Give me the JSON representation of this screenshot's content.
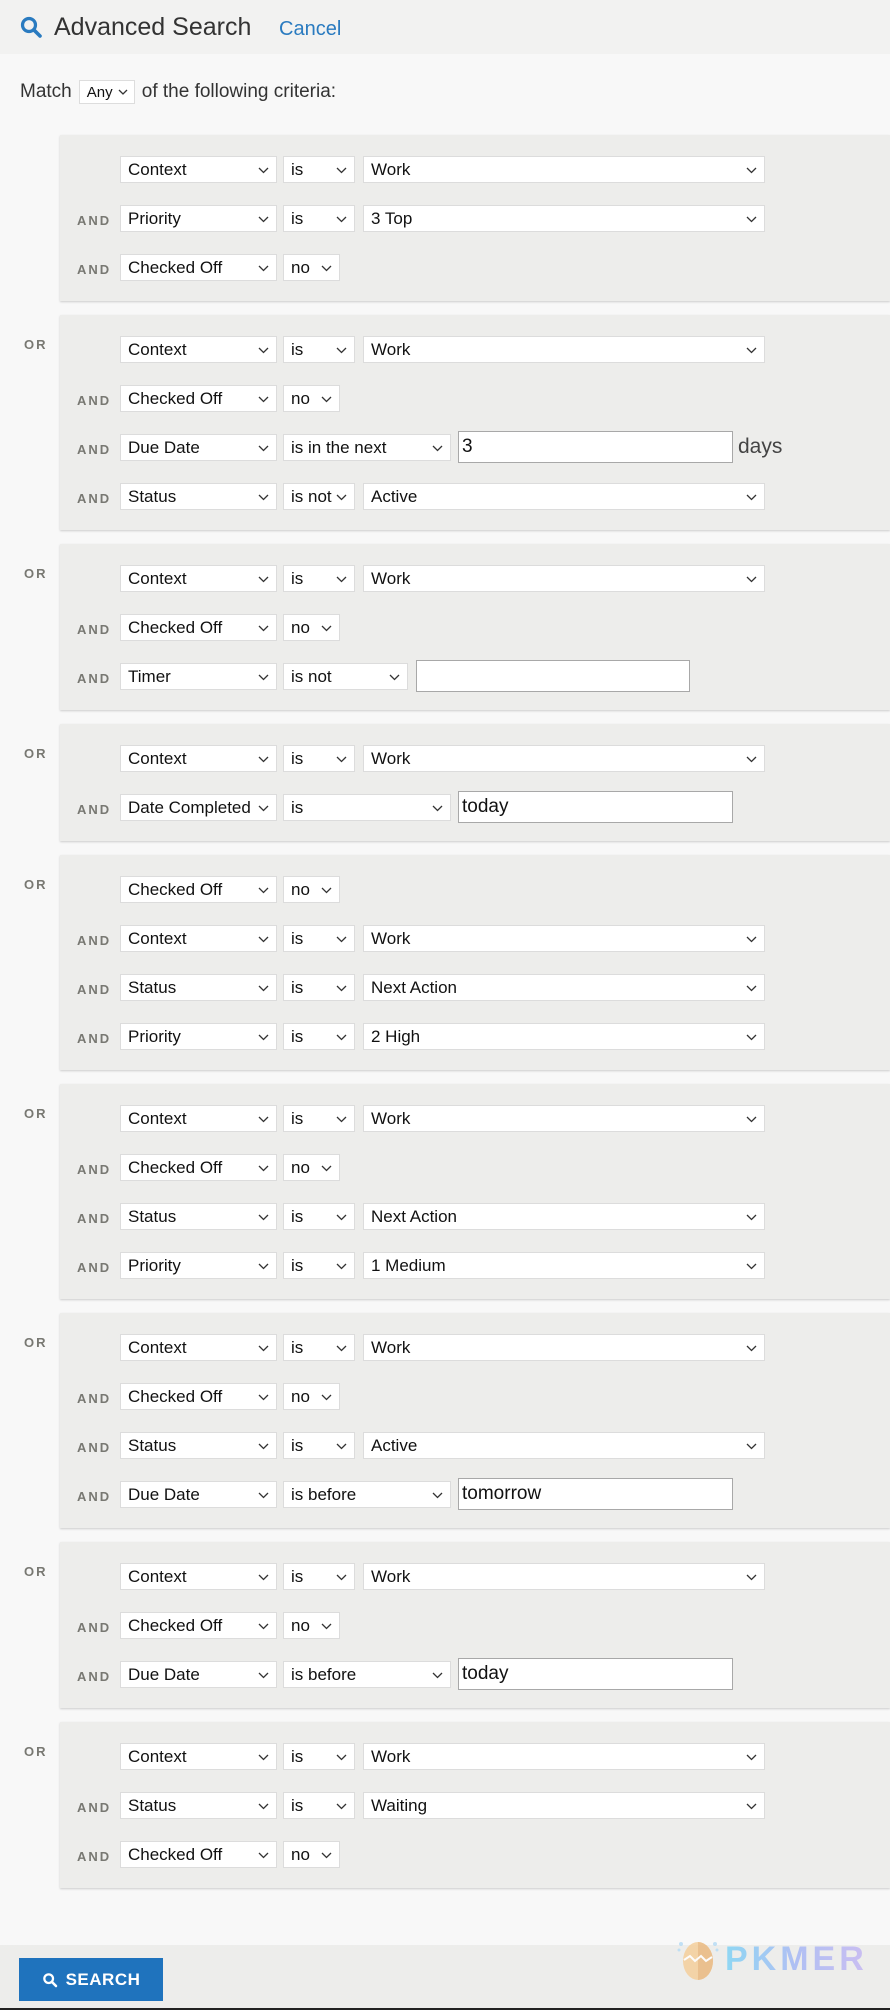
{
  "header": {
    "title": "Advanced Search",
    "cancel_label": "Cancel",
    "icon": "search-icon",
    "accent_color": "#2a7bc0"
  },
  "match": {
    "prefix": "Match",
    "mode": "Any",
    "suffix": "of the following criteria:"
  },
  "connectors": {
    "and": "AND",
    "or": "OR"
  },
  "groups": [
    {
      "rows": [
        {
          "field": "Context",
          "op": "is",
          "value": "Work"
        },
        {
          "field": "Priority",
          "op": "is",
          "value": "3 Top"
        },
        {
          "field": "Checked Off",
          "op": "no"
        }
      ]
    },
    {
      "rows": [
        {
          "field": "Context",
          "op": "is",
          "value": "Work"
        },
        {
          "field": "Checked Off",
          "op": "no"
        },
        {
          "field": "Due Date",
          "op": "is in the next",
          "input": "3",
          "unit": "days"
        },
        {
          "field": "Status",
          "op": "is not",
          "value": "Active"
        }
      ]
    },
    {
      "rows": [
        {
          "field": "Context",
          "op": "is",
          "value": "Work"
        },
        {
          "field": "Checked Off",
          "op": "no"
        },
        {
          "field": "Timer",
          "op": "is not",
          "input": ""
        }
      ]
    },
    {
      "rows": [
        {
          "field": "Context",
          "op": "is",
          "value": "Work"
        },
        {
          "field": "Date Completed",
          "op": "is",
          "input": "today"
        }
      ]
    },
    {
      "rows": [
        {
          "field": "Checked Off",
          "op": "no"
        },
        {
          "field": "Context",
          "op": "is",
          "value": "Work"
        },
        {
          "field": "Status",
          "op": "is",
          "value": "Next Action"
        },
        {
          "field": "Priority",
          "op": "is",
          "value": "2 High"
        }
      ]
    },
    {
      "rows": [
        {
          "field": "Context",
          "op": "is",
          "value": "Work"
        },
        {
          "field": "Checked Off",
          "op": "no"
        },
        {
          "field": "Status",
          "op": "is",
          "value": "Next Action"
        },
        {
          "field": "Priority",
          "op": "is",
          "value": "1 Medium"
        }
      ]
    },
    {
      "rows": [
        {
          "field": "Context",
          "op": "is",
          "value": "Work"
        },
        {
          "field": "Checked Off",
          "op": "no"
        },
        {
          "field": "Status",
          "op": "is",
          "value": "Active"
        },
        {
          "field": "Due Date",
          "op": "is before",
          "input": "tomorrow"
        }
      ]
    },
    {
      "rows": [
        {
          "field": "Context",
          "op": "is",
          "value": "Work"
        },
        {
          "field": "Checked Off",
          "op": "no"
        },
        {
          "field": "Due Date",
          "op": "is before",
          "input": "today"
        }
      ]
    },
    {
      "rows": [
        {
          "field": "Context",
          "op": "is",
          "value": "Work"
        },
        {
          "field": "Status",
          "op": "is",
          "value": "Waiting"
        },
        {
          "field": "Checked Off",
          "op": "no"
        }
      ]
    }
  ],
  "footer": {
    "search_label": "SEARCH",
    "button_color": "#1f73bd",
    "watermark": "PKMER"
  }
}
